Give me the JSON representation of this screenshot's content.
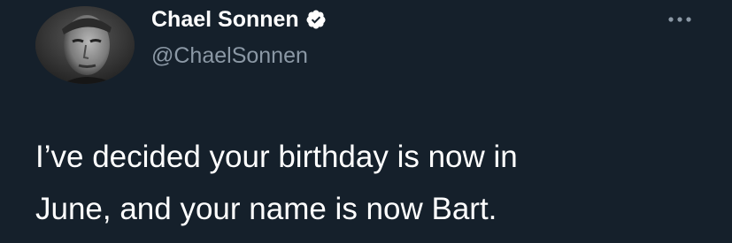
{
  "author": {
    "display_name": "Chael Sonnen",
    "handle": "@ChaelSonnen",
    "verified": true
  },
  "tweet": {
    "text_lines": [
      "I’ve decided your birthday is now in",
      "June, and your name is now Bart."
    ]
  },
  "icons": {
    "verified": "verified-badge-icon",
    "more": "more-options-icon"
  },
  "colors": {
    "background": "#15202b",
    "primary_text": "#ffffff",
    "secondary_text": "#8b98a5"
  }
}
